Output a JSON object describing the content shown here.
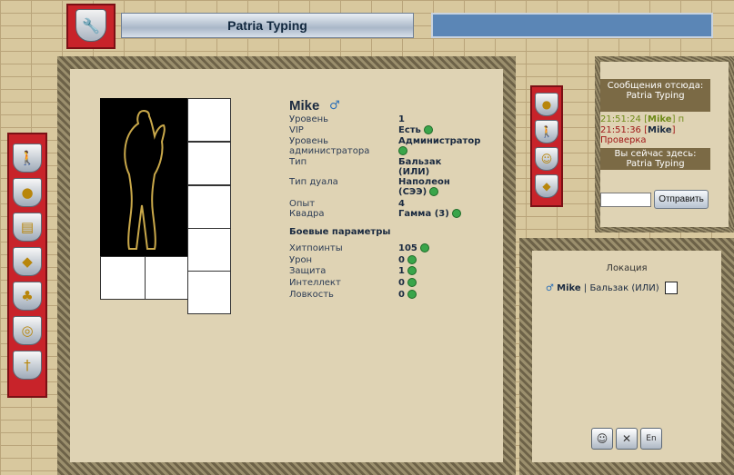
{
  "header": {
    "title": "Patria Typing",
    "shield_icon": "wrench-icon"
  },
  "left_menu": {
    "icons": [
      "figure-icon",
      "ball-icon",
      "scroll-icon",
      "bag-icon",
      "sack-icon",
      "coins-icon",
      "anchor-icon"
    ]
  },
  "profile": {
    "name": "Mike",
    "rows": [
      {
        "label": "Уровень",
        "value": "1",
        "help": false
      },
      {
        "label": "VIP",
        "value": "Есть",
        "help": true
      },
      {
        "label": "Уровень администратора",
        "value": "Администратор",
        "help": true
      },
      {
        "label": "Тип",
        "value": "Бальзак (ИЛИ)",
        "help": false
      },
      {
        "label": "Тип дуала",
        "value": "Наполеон (СЭЭ)",
        "help": true
      },
      {
        "label": "Опыт",
        "value": "4",
        "help": false
      },
      {
        "label": "Квадра",
        "value": "Гамма (3)",
        "help": true
      }
    ],
    "combat_title": "Боевые параметры",
    "combat_rows": [
      {
        "label": "Хитпоинты",
        "value": "105"
      },
      {
        "label": "Урон",
        "value": "0"
      },
      {
        "label": "Защита",
        "value": "1"
      },
      {
        "label": "Интеллект",
        "value": "0"
      },
      {
        "label": "Ловкость",
        "value": "0"
      }
    ]
  },
  "right_menu": {
    "icons": [
      "coin-icon",
      "figure-icon",
      "smile-icon",
      "diamond-icon"
    ]
  },
  "chat": {
    "header": "Сообщения отсюда: Patria Typing",
    "messages": [
      {
        "time": "21:51:24",
        "user": "Mike",
        "text": "п",
        "color": "#6e8a18"
      },
      {
        "time": "21:51:36",
        "user": "Mike",
        "text": "",
        "color": "#a01818"
      },
      {
        "time": "",
        "user": "",
        "text": "Проверка",
        "color": "#a01818"
      }
    ],
    "here_label": "Вы сейчас здесь: Patria Typing",
    "send_label": "Отправить"
  },
  "location": {
    "title": "Локация",
    "user": "Mike",
    "type": "Бальзак (ИЛИ)"
  },
  "bottom_buttons": [
    "smile-icon",
    "close-icon",
    "keyboard-icon"
  ],
  "bottom_labels": [
    "☺",
    "✕",
    "En"
  ]
}
